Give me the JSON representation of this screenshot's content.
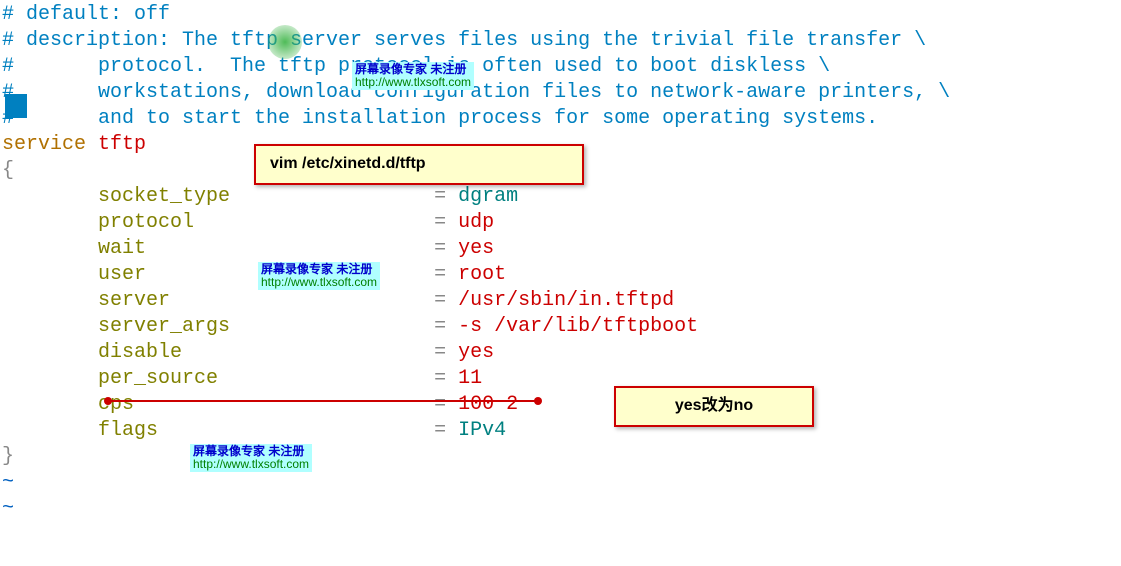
{
  "lines": {
    "c1": "# default: off",
    "c2": "# description: The tftp server serves files using the trivial file transfer \\",
    "c3": "#       protocol.  The tftp protocol is often used to boot diskless \\",
    "c4": "#       workstations, download configuration files to network-aware printers, \\",
    "c5": "#       and to start the installation process for some operating systems.",
    "svc_kw": "service",
    "svc_name": " tftp",
    "brace_open": "{",
    "brace_close": "}",
    "tilde": "~"
  },
  "config": [
    {
      "key": "socket_type",
      "val": "dgram",
      "valcls": "val-type"
    },
    {
      "key": "protocol",
      "val": "udp",
      "valcls": "val-str"
    },
    {
      "key": "wait",
      "val": "yes",
      "valcls": "val-str"
    },
    {
      "key": "user",
      "val": "root",
      "valcls": "val-str"
    },
    {
      "key": "server",
      "val": "/usr/sbin/in.tftpd",
      "valcls": "val-str"
    },
    {
      "key": "server_args",
      "val": "-s /var/lib/tftpboot",
      "valcls": "val-str"
    },
    {
      "key": "disable",
      "val": "yes",
      "valcls": "val-str"
    },
    {
      "key": "per_source",
      "val": "11",
      "valcls": "val-num"
    },
    {
      "key": "cps",
      "val": "100 2",
      "valcls": "val-num"
    },
    {
      "key": "flags",
      "val": "IPv4",
      "valcls": "val-type"
    }
  ],
  "watermark": {
    "line1": "屏幕录像专家   未注册",
    "line2": "http://www.tlxsoft.com"
  },
  "callouts": {
    "vim_cmd": "vim  /etc/xinetd.d/tftp",
    "change_note": "yes改为no"
  }
}
